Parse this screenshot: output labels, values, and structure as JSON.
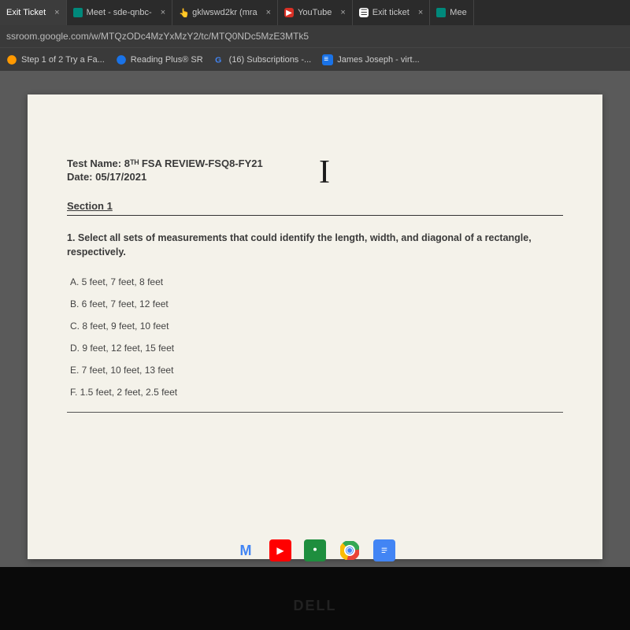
{
  "tabs": [
    {
      "label": "Exit Ticket",
      "active": true
    },
    {
      "label": "Meet - sde-qnbc-",
      "active": false
    },
    {
      "label": "gklwswd2kr (mra",
      "active": false
    },
    {
      "label": "YouTube",
      "active": false
    },
    {
      "label": "Exit ticket",
      "active": false
    },
    {
      "label": "Mee",
      "active": false
    }
  ],
  "url": "ssroom.google.com/w/MTQzODc4MzYxMzY2/tc/MTQ0NDc5MzE3MTk5",
  "bookmarks": [
    {
      "label": "Step 1 of 2 Try a Fa..."
    },
    {
      "label": "Reading Plus® SR"
    },
    {
      "label": "(16) Subscriptions -..."
    },
    {
      "label": "James Joseph - virt..."
    }
  ],
  "doc": {
    "test_name_label": "Test Name: 8ᵀᴴ FSA REVIEW-FSQ8-FY21",
    "date_label": "Date: 05/17/2021",
    "section": "Section 1",
    "question": "1.  Select all sets of measurements that could identify the length, width, and diagonal of a rectangle, respectively.",
    "answers": [
      "A. 5 feet, 7 feet, 8 feet",
      "B. 6 feet, 7 feet, 12 feet",
      "C. 8 feet, 9 feet, 10 feet",
      "D. 9 feet, 12 feet, 15 feet",
      "E. 7 feet, 10 feet, 13 feet",
      "F. 1.5 feet, 2 feet, 2.5 feet"
    ]
  },
  "brand": "DELL"
}
